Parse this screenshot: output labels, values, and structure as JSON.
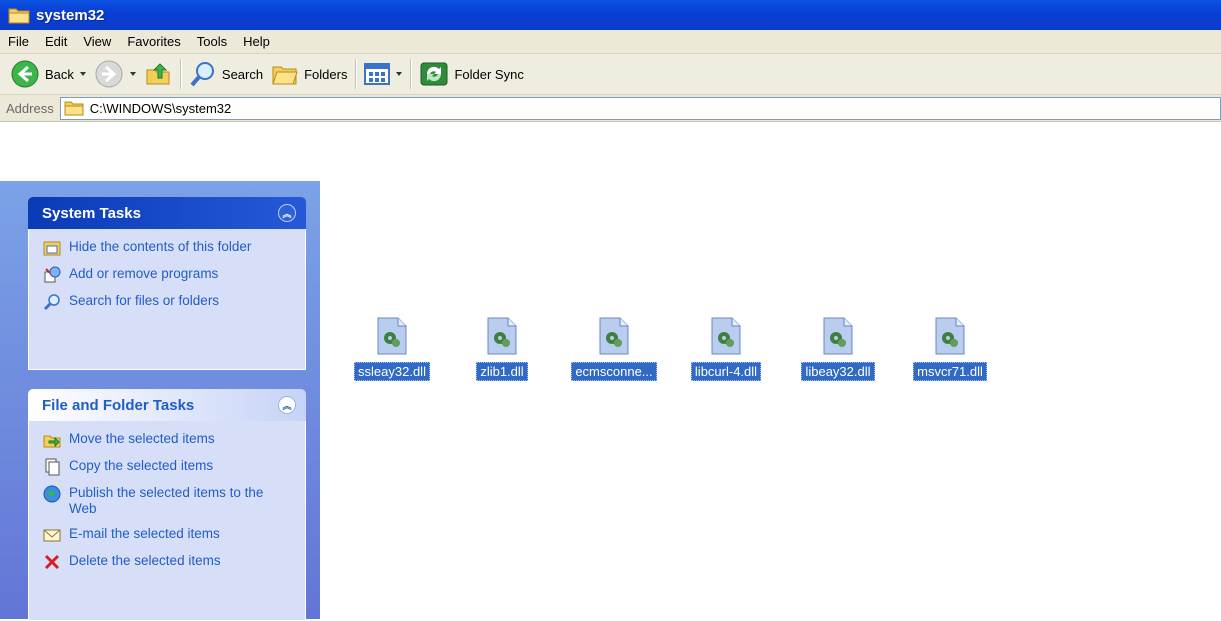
{
  "window": {
    "title": "system32"
  },
  "menu": [
    "File",
    "Edit",
    "View",
    "Favorites",
    "Tools",
    "Help"
  ],
  "toolbar": {
    "back_label": "Back",
    "search_label": "Search",
    "folders_label": "Folders",
    "sync_label": "Folder Sync"
  },
  "address": {
    "label": "Address",
    "value": "C:\\WINDOWS\\system32"
  },
  "system_tasks": {
    "title": "System Tasks",
    "items": [
      {
        "label": "Hide the contents of this folder",
        "icon": "folder-view-icon"
      },
      {
        "label": "Add or remove programs",
        "icon": "add-remove-programs-icon"
      },
      {
        "label": "Search for files or folders",
        "icon": "search-icon"
      }
    ]
  },
  "file_tasks": {
    "title": "File and Folder Tasks",
    "items": [
      {
        "label": "Move the selected items",
        "icon": "move-icon"
      },
      {
        "label": "Copy the selected items",
        "icon": "copy-icon"
      },
      {
        "label": "Publish the selected items to the Web",
        "icon": "publish-web-icon"
      },
      {
        "label": "E-mail the selected items",
        "icon": "email-icon"
      },
      {
        "label": "Delete the selected items",
        "icon": "delete-icon"
      }
    ]
  },
  "files": [
    {
      "name": "ssleay32.dll"
    },
    {
      "name": "zlib1.dll"
    },
    {
      "name": "ecmsconne..."
    },
    {
      "name": "libcurl-4.dll"
    },
    {
      "name": "libeay32.dll"
    },
    {
      "name": "msvcr71.dll"
    }
  ],
  "colors": {
    "title_bar": "#0a3fd6",
    "task_link": "#215dc6",
    "selection": "#316ac5",
    "pane_bg": "#6375d6"
  }
}
